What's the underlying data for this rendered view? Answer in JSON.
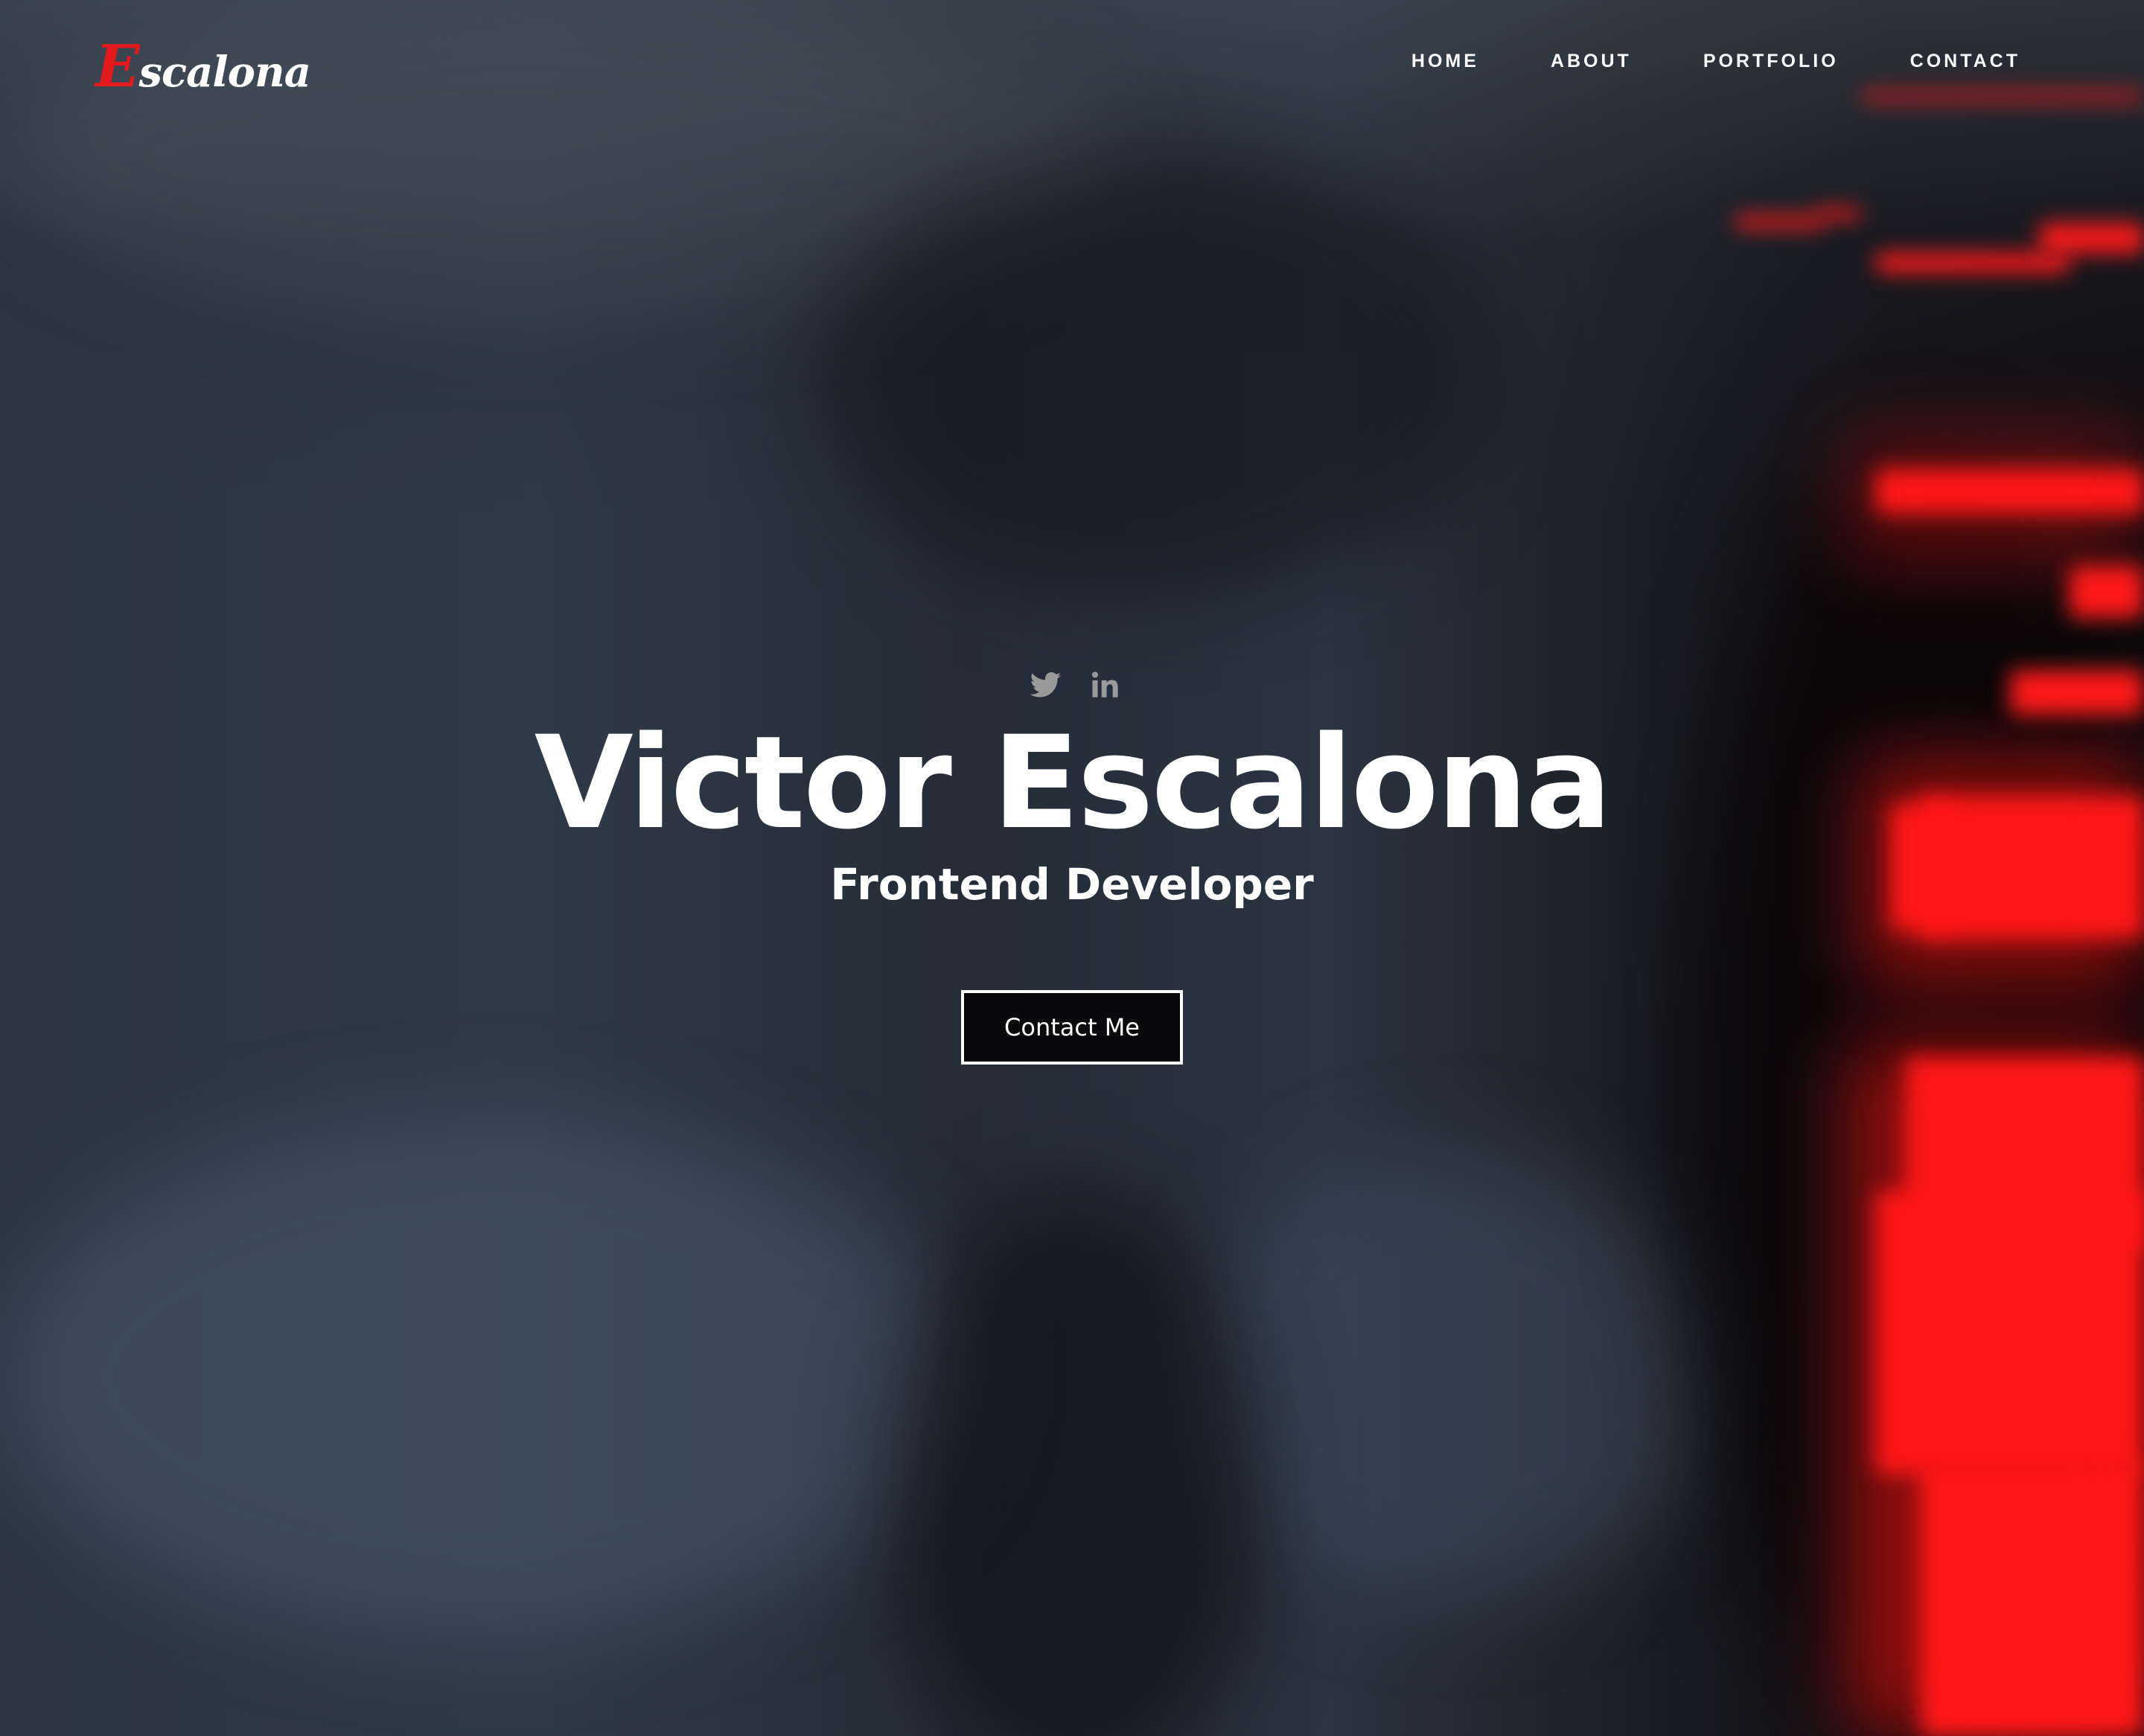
{
  "brand": {
    "logo_initial": "E",
    "logo_rest": "scalona",
    "accent_color": "#e3191c"
  },
  "nav": {
    "items": [
      {
        "label": "HOME"
      },
      {
        "label": "ABOUT"
      },
      {
        "label": "PORTFOLIO"
      },
      {
        "label": "CONTACT"
      }
    ]
  },
  "hero": {
    "socials": [
      {
        "icon": "twitter-icon"
      },
      {
        "icon": "linkedin-icon"
      }
    ],
    "name": "Victor Escalona",
    "role": "Frontend Developer",
    "cta_label": "Contact Me"
  }
}
